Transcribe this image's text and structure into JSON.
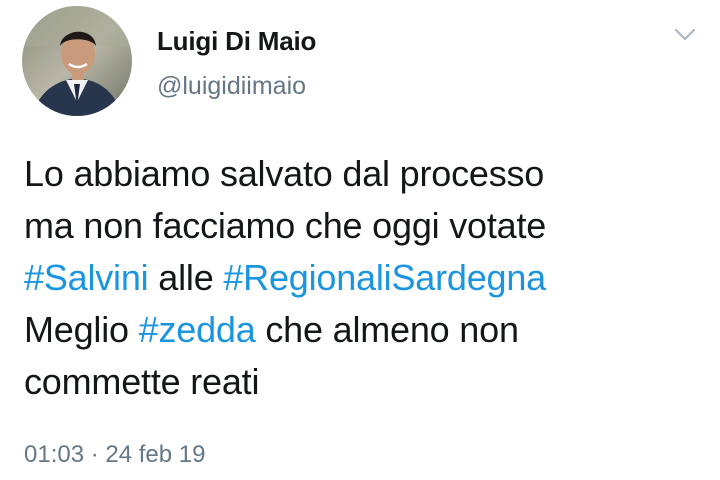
{
  "author": {
    "name": "Luigi Di Maio",
    "handle": "@luigidiimaio"
  },
  "tweet": {
    "line1": "Lo abbiamo salvato dal processo",
    "line2": "ma non facciamo che oggi votate",
    "hashtag_salvini": "#Salvini",
    "word_alle": " alle ",
    "hashtag_regionali": "#RegionaliSardegna",
    "word_meglio": "Meglio ",
    "hashtag_zedda": "#zedda",
    "line4_rest": " che almeno non",
    "line5": "commette reati"
  },
  "meta": {
    "time": "01:03",
    "separator": " · ",
    "date": "24 feb 19"
  },
  "icons": {
    "menu": "chevron-down-icon",
    "avatar": "profile-photo"
  },
  "colors": {
    "text": "#14171a",
    "secondary": "#657786",
    "link": "#1b95e0"
  }
}
